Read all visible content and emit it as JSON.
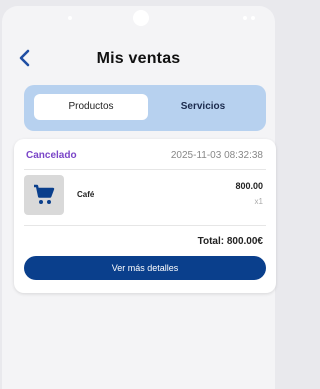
{
  "header": {
    "title": "Mis ventas",
    "back_icon": "chevron-left-icon"
  },
  "tabs": [
    {
      "label": "Productos",
      "active": true
    },
    {
      "label": "Servicios",
      "active": false
    }
  ],
  "sale": {
    "status": "Cancelado",
    "status_color": "#7a45c8",
    "datetime": "2025-11-03 08:32:38",
    "items": [
      {
        "name": "Café",
        "price": "800.00",
        "quantity": "x1",
        "icon": "shopping-cart-icon"
      }
    ],
    "total": "Total: 800.00€",
    "details_label": "Ver más detalles"
  },
  "colors": {
    "accent": "#0a3f8c",
    "segment_bg": "#b7d1ef",
    "back": "#1f4ea3"
  }
}
